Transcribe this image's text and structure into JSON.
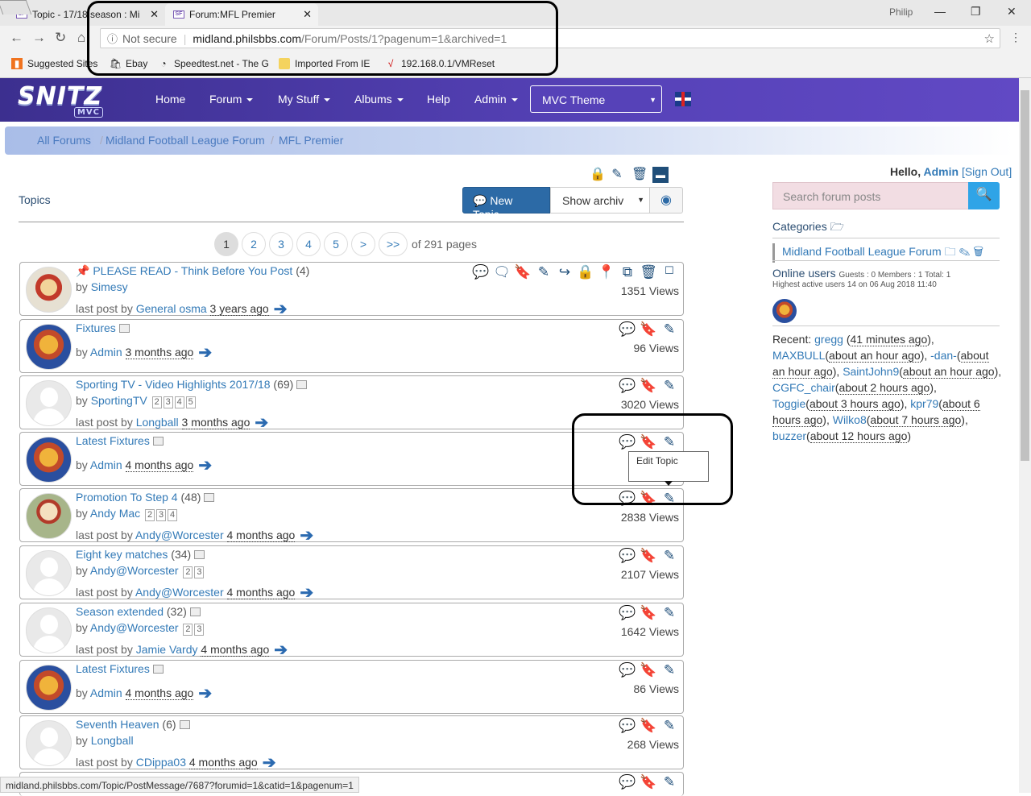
{
  "browser": {
    "tab1": "Topic - 17/18 season : Mi",
    "tab2": "Forum:MFL Premier",
    "user": "Philip",
    "security": "Not secure",
    "url_host": "midland.philsbbs.com",
    "url_path": "/Forum/Posts/1?pagenum=1&archived=1",
    "bookmarks": [
      "Suggested Sites",
      "Ebay",
      "Speedtest.net - The G",
      "Imported From IE",
      "192.168.0.1/VMReset"
    ]
  },
  "site": {
    "logo": "SNITZ",
    "logo_sub": "MVC",
    "nav": [
      "Home",
      "Forum",
      "My Stuff",
      "Albums",
      "Help",
      "Admin"
    ],
    "theme": "MVC Theme"
  },
  "breadcrumb": [
    "All Forums",
    "Midland Football League Forum",
    "MFL Premier"
  ],
  "main": {
    "topics_label": "Topics",
    "new_topic": "New Topic",
    "archive_select": "Show archiv",
    "pages": [
      "1",
      "2",
      "3",
      "4",
      "5",
      ">",
      ">>"
    ],
    "page_of": "of 291 pages"
  },
  "topics": [
    {
      "title": "PLEASE READ - Think Before You Post",
      "count": "(4)",
      "by": "by",
      "author": "Simesy",
      "last_label": "last post by",
      "last_author": "General osma",
      "ago": "3 years ago",
      "views": "1351 Views"
    },
    {
      "title": "Fixtures",
      "count": "",
      "by": "by",
      "author": "Admin",
      "last_label": "",
      "last_author": "",
      "ago": "3 months ago",
      "views": "96 Views"
    },
    {
      "title": "Sporting TV - Video Highlights 2017/18",
      "count": "(69)",
      "by": "by",
      "author": "SportingTV",
      "pages": [
        "2",
        "3",
        "4",
        "5"
      ],
      "last_label": "last post by",
      "last_author": "Longball",
      "ago": "3 months ago",
      "views": "3020 Views"
    },
    {
      "title": "Latest Fixtures",
      "count": "",
      "by": "by",
      "author": "Admin",
      "last_label": "",
      "last_author": "",
      "ago": "4 months ago",
      "views": ""
    },
    {
      "title": "Promotion To Step 4",
      "count": "(48)",
      "by": "by",
      "author": "Andy Mac",
      "pages": [
        "2",
        "3",
        "4"
      ],
      "last_label": "last post by",
      "last_author": "Andy@Worcester",
      "ago": "4 months ago",
      "views": "2838 Views"
    },
    {
      "title": "Eight key matches",
      "count": "(34)",
      "by": "by",
      "author": "Andy@Worcester",
      "pages": [
        "2",
        "3"
      ],
      "last_label": "last post by",
      "last_author": "Andy@Worcester",
      "ago": "4 months ago",
      "views": "2107 Views"
    },
    {
      "title": "Season extended",
      "count": "(32)",
      "by": "by",
      "author": "Andy@Worcester",
      "pages": [
        "2",
        "3"
      ],
      "last_label": "last post by",
      "last_author": "Jamie Vardy",
      "ago": "4 months ago",
      "views": "1642 Views"
    },
    {
      "title": "Latest Fixtures",
      "count": "",
      "by": "by",
      "author": "Admin",
      "last_label": "",
      "last_author": "",
      "ago": "4 months ago",
      "views": "86 Views"
    },
    {
      "title": "Seventh Heaven",
      "count": "(6)",
      "by": "by",
      "author": "Longball",
      "last_label": "last post by",
      "last_author": "CDippa03",
      "ago": "4 months ago",
      "views": "268 Views"
    }
  ],
  "tooltip": "Edit Topic",
  "sidebar": {
    "hello": "Hello,",
    "user": "Admin",
    "sign_out": "[Sign Out]",
    "search_placeholder": "Search forum posts",
    "categories": "Categories",
    "category_item": "Midland Football League Forum",
    "online_title": "Online users",
    "online_stats": "Guests : 0 Members : 1 Total: 1",
    "highest": "Highest active users 14 on 06 Aug 2018 11:40",
    "recent_label": "Recent:",
    "recent": [
      {
        "name": "gregg",
        "ago": "41 minutes ago"
      },
      {
        "name": "MAXBULL",
        "ago": "about an hour ago"
      },
      {
        "name": "-dan-",
        "ago": "about an hour ago"
      },
      {
        "name": "SaintJohn9",
        "ago": "about an hour ago"
      },
      {
        "name": "CGFC_chair",
        "ago": "about 2 hours ago"
      },
      {
        "name": "Toggie",
        "ago": "about 3 hours ago"
      },
      {
        "name": "kpr79",
        "ago": "about 6 hours ago"
      },
      {
        "name": "Wilko8",
        "ago": "about 7 hours ago"
      },
      {
        "name": "buzzer",
        "ago": "about 12 hours ago"
      }
    ]
  },
  "status_url": "midland.philsbbs.com/Topic/PostMessage/7687?forumid=1&catid=1&pagenum=1"
}
